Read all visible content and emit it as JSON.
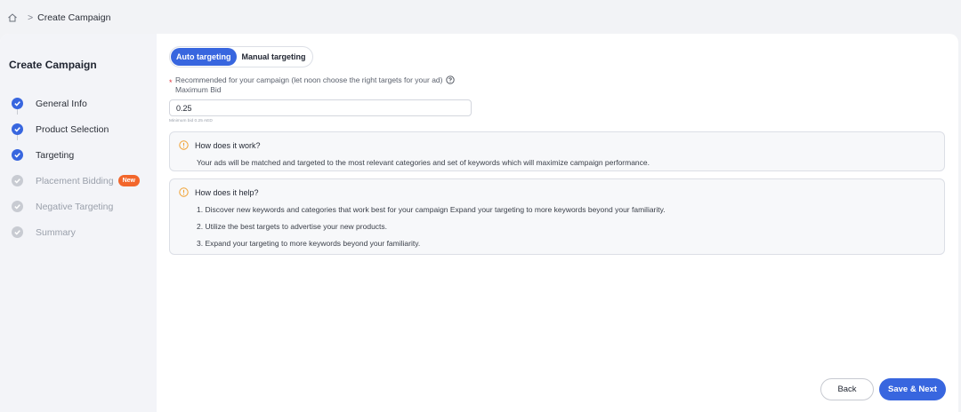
{
  "breadcrumb": {
    "home_icon": "home-icon",
    "separator": ">",
    "current": "Create Campaign"
  },
  "sidebar": {
    "title": "Create Campaign",
    "steps": [
      {
        "label": "General Info",
        "status": "done"
      },
      {
        "label": "Product Selection",
        "status": "done"
      },
      {
        "label": "Targeting",
        "status": "done"
      },
      {
        "label": "Placement Bidding",
        "status": "todo",
        "badge": "New"
      },
      {
        "label": "Negative Targeting",
        "status": "todo"
      },
      {
        "label": "Summary",
        "status": "todo"
      }
    ]
  },
  "targeting": {
    "tabs": [
      "Auto targeting",
      "Manual targeting"
    ],
    "active_tab": "Auto targeting",
    "required_mark": "*",
    "recommendation": "Recommended for your campaign (let noon choose the right targets for your ad)",
    "bid_label": "Maximum Bid",
    "bid_value": "0.25",
    "bid_hint": "Minimum bid 0.25 AED"
  },
  "how_it_works": {
    "title": "How does it work?",
    "text": "Your ads will be matched and targeted to the most relevant categories and set of keywords which will maximize campaign performance."
  },
  "how_it_helps": {
    "title": "How does it help?",
    "points": [
      "1. Discover new keywords and categories that work best for your campaign Expand your targeting to more keywords beyond your familiarity.",
      "2. Utilize the best targets to advertise your new products.",
      "3. Expand your targeting to more keywords beyond your familiarity."
    ]
  },
  "actions": {
    "back": "Back",
    "next": "Save & Next"
  },
  "colors": {
    "accent": "#3866df",
    "badge": "#f2662b",
    "warning_icon": "#f0a030"
  }
}
